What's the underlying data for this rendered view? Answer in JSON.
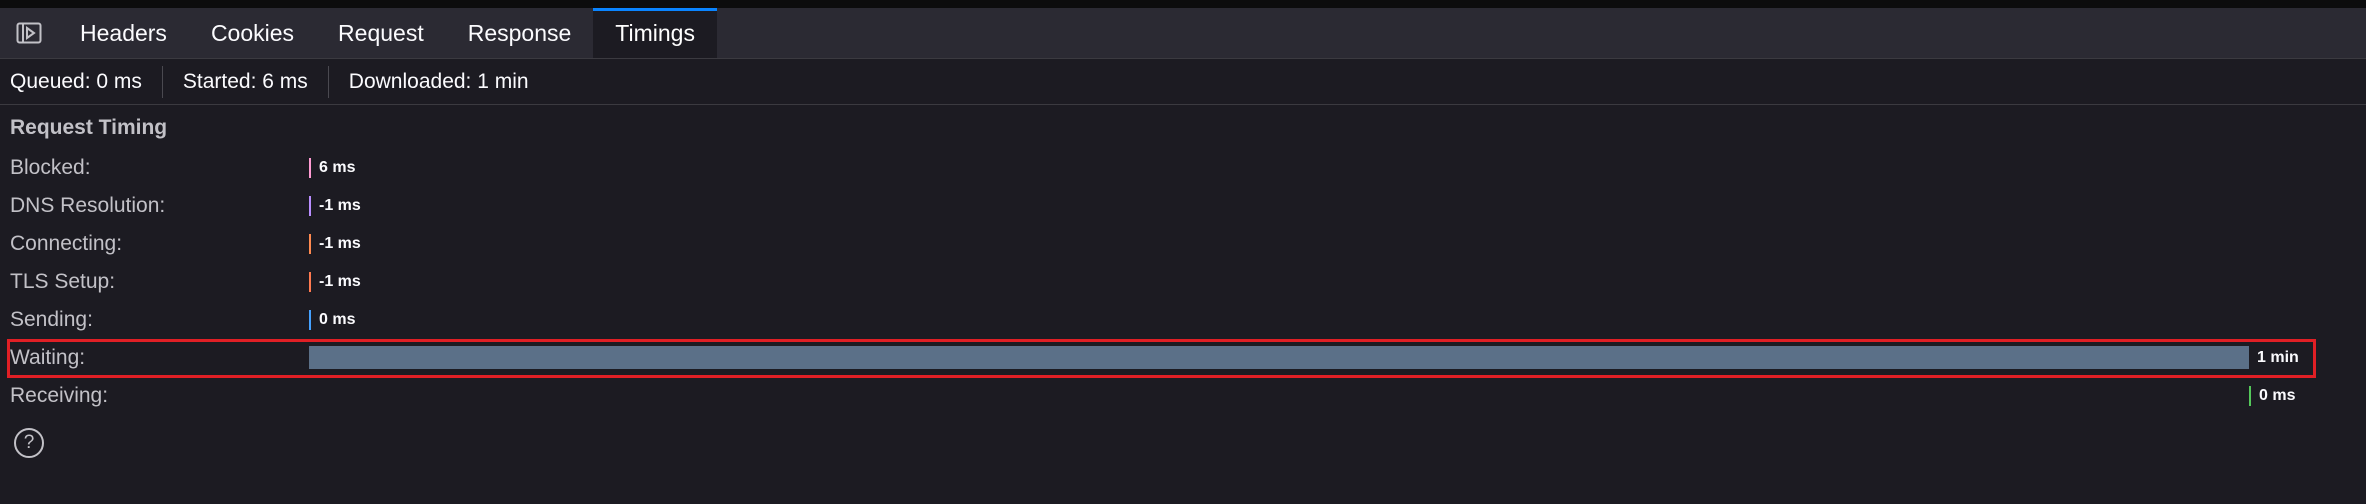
{
  "tabs": [
    {
      "label": "Headers",
      "selected": false
    },
    {
      "label": "Cookies",
      "selected": false
    },
    {
      "label": "Request",
      "selected": false
    },
    {
      "label": "Response",
      "selected": false
    },
    {
      "label": "Timings",
      "selected": true
    }
  ],
  "icons": {
    "panel_toggle": "sidebar-toggle-icon",
    "help": "help-icon",
    "help_glyph": "?"
  },
  "summary": {
    "queued": "Queued: 0 ms",
    "started": "Started: 6 ms",
    "downloaded": "Downloaded: 1 min"
  },
  "section_title": "Request Timing",
  "timings": [
    {
      "label": "Blocked:",
      "value": "6 ms",
      "color": "#ff9bd3",
      "start_fraction": 0.0,
      "width_fraction": 0.0
    },
    {
      "label": "DNS Resolution:",
      "value": "-1 ms",
      "color": "#b98eff",
      "start_fraction": 0.0,
      "width_fraction": 0.0
    },
    {
      "label": "Connecting:",
      "value": "-1 ms",
      "color": "#ff8a50",
      "start_fraction": 0.0,
      "width_fraction": 0.0
    },
    {
      "label": "TLS Setup:",
      "value": "-1 ms",
      "color": "#ff7a50",
      "start_fraction": 0.0,
      "width_fraction": 0.0
    },
    {
      "label": "Sending:",
      "value": "0 ms",
      "color": "#45a1ff",
      "start_fraction": 0.0,
      "width_fraction": 0.0
    },
    {
      "label": "Waiting:",
      "value": "1 min",
      "color": "#5b7088",
      "start_fraction": 0.0,
      "width_fraction": 1.0,
      "highlighted": true
    },
    {
      "label": "Receiving:",
      "value": "0 ms",
      "color": "#54c85a",
      "start_fraction": 1.0,
      "width_fraction": 0.0
    }
  ],
  "colors": {
    "highlight": "#e01f25",
    "tab_accent": "#0a84ff"
  }
}
